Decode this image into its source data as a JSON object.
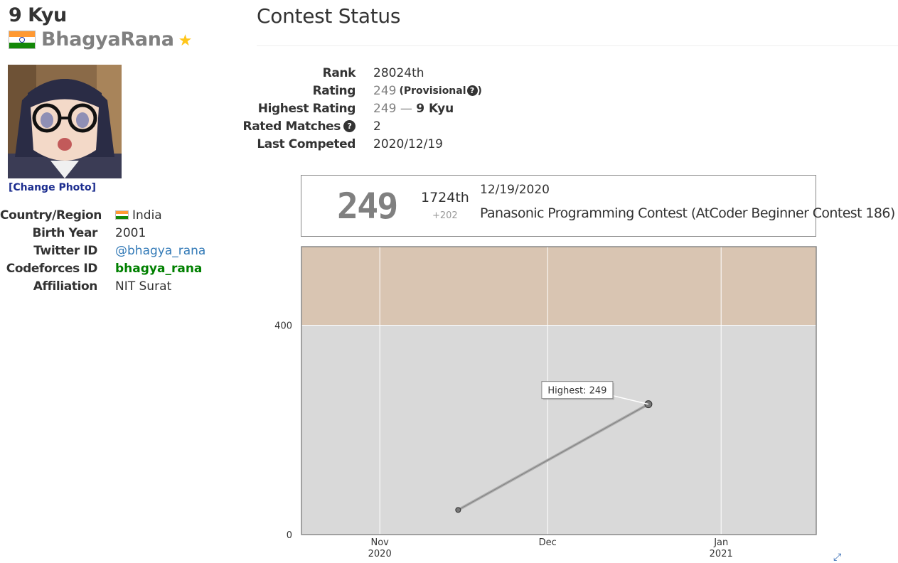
{
  "profile": {
    "kyu": "9 Kyu",
    "username": "BhagyaRana",
    "change_photo": "[Change Photo]",
    "fields": {
      "country_label": "Country/Region",
      "country_value": "India",
      "birth_label": "Birth Year",
      "birth_value": "2001",
      "twitter_label": "Twitter ID",
      "twitter_value": "@bhagya_rana",
      "codeforces_label": "Codeforces ID",
      "codeforces_value": "bhagya_rana",
      "affiliation_label": "Affiliation",
      "affiliation_value": "NIT Surat"
    }
  },
  "contest_status": {
    "heading": "Contest Status",
    "rank_label": "Rank",
    "rank_value": "28024th",
    "rating_label": "Rating",
    "rating_value": "249",
    "rating_note": "(Provisional",
    "highest_label": "Highest Rating",
    "highest_value": "249",
    "highest_sep": " — ",
    "highest_kyu": "9 Kyu",
    "matches_label": "Rated Matches",
    "matches_value": "2",
    "last_label": "Last Competed",
    "last_value": "2020/12/19"
  },
  "contest_card": {
    "rating": "249",
    "place": "1724th",
    "diff": "+202",
    "date": "12/19/2020",
    "contest_name": "Panasonic Programming Contest (AtCoder Beginner Contest 186)"
  },
  "colors": {
    "gray_rating": "#808080",
    "brown_band": "#d9c5b2",
    "gray_band": "#d9d9d9",
    "codeforces_green": "#008000",
    "link_blue": "#337ab7",
    "star": "#ffc61a"
  },
  "icons": {
    "flag": "india-flag-icon",
    "star": "star-icon",
    "help": "question-circle-icon",
    "expand": "expand-arrows-icon"
  },
  "chart_data": {
    "type": "line",
    "x": [
      "2020-11-15",
      "2020-12-19"
    ],
    "values": [
      47,
      249
    ],
    "xlim": [
      "2020-10-18",
      "2021-01-18"
    ],
    "ylim": [
      0,
      550
    ],
    "y_ticks": [
      "0",
      "400"
    ],
    "x_ticks": [
      {
        "date": "2020-11-01",
        "line1": "Nov",
        "line2": "2020"
      },
      {
        "date": "2020-12-01",
        "line1": "Dec",
        "line2": ""
      },
      {
        "date": "2021-01-01",
        "line1": "Jan",
        "line2": "2021"
      }
    ],
    "bands": [
      {
        "from": 0,
        "to": 400,
        "color": "#d9d9d9"
      },
      {
        "from": 400,
        "to": 550,
        "color": "#d9c5b2"
      }
    ],
    "highlight_label": "Highest: 249",
    "grid": true
  }
}
